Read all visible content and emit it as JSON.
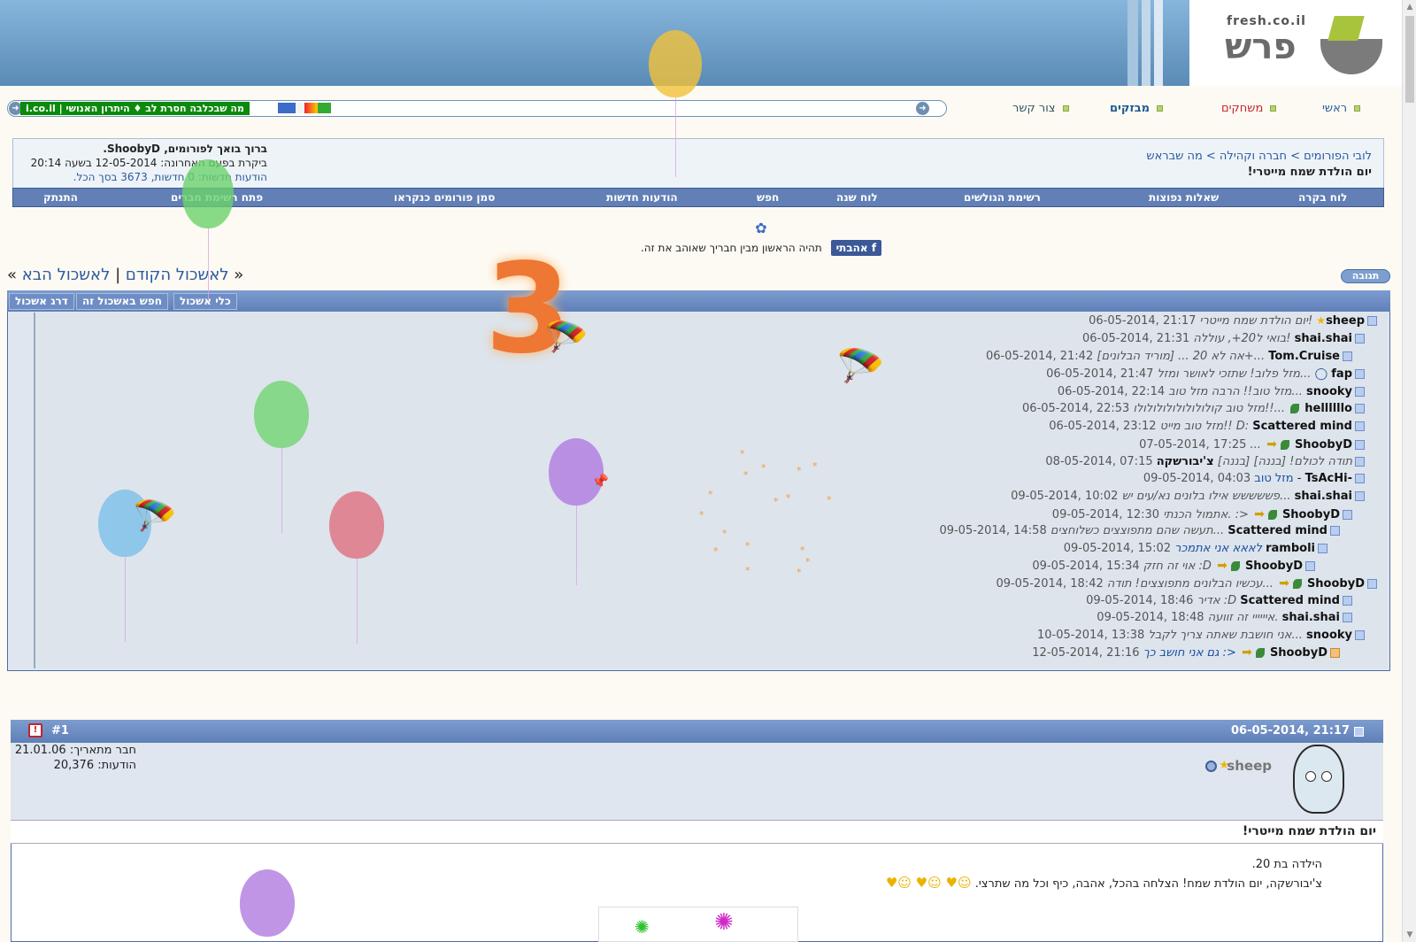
{
  "site": {
    "logo_url_text": "fresh.co.il",
    "logo_text": "פרש"
  },
  "top_nav": [
    "ראשי",
    "משחקים",
    "מבזקים",
    "צור קשר"
  ],
  "ticker": {
    "message": "מה שבכלבה חסרת לב ♦ היתרון האנושי | i.co.il"
  },
  "welcome": {
    "line1": "ברוך בואך לפורומים, ShoobyD.",
    "line2": "ביקרת בפעם האחרונה: 12-05-2014 בשעה 20:14",
    "line3": "הודעות חדשות: 0 חדשות, 3673 בסך הכל."
  },
  "breadcrumb": {
    "path": "לובי הפורומים > חברה וקהילה > מה שבראש",
    "title": "יום הולדת שמח מייטרי!"
  },
  "navbar": [
    "לוח בקרה",
    "שאלות נפוצות",
    "רשימת הגולשים",
    "לוח שנה",
    "חפש",
    "הודעות חדשות",
    "סמן פורומים כנקראו",
    "פתח רשימת חברים",
    "התנתק"
  ],
  "facebook": {
    "like_label": "אהבתי",
    "text": "תהיה הראשון מבין חבריך שאוהב את זה."
  },
  "thread_nav": {
    "prev": "לאשכול הקודם",
    "next": "לאשכול הבא",
    "sep": "|"
  },
  "reply_label": "תגובה",
  "thread_tools": [
    "כלי אשכול",
    "חפש באשכול זה",
    "דרג אשכול"
  ],
  "thread": [
    {
      "user": "sheep",
      "title": "יום הולדת שמח מייטרי!",
      "date": "06-05-2014, 21:17"
    },
    {
      "user": "shai.shai",
      "title": "בואי ל20+, עוללה!",
      "date": "06-05-2014, 21:31"
    },
    {
      "user": "Tom.Cruise",
      "title": "[מוריד הבלונים] ... אה לא 20+...",
      "date": "06-05-2014, 21:42"
    },
    {
      "user": "fap",
      "title": "מזל פלוב! שתזכי לאושר ומזל...",
      "date": "06-05-2014, 21:47"
    },
    {
      "user": "snooky",
      "title": "מזל טוב!! הרבה מזל טוב...",
      "date": "06-05-2014, 22:14"
    },
    {
      "user": "hellllllo",
      "title": "מזל טוב קולולולולולולולולו!!...",
      "date": "06-05-2014, 22:53"
    },
    {
      "user": "Scattered mind",
      "title": "מזל טוב מייט!! D:",
      "date": "06-05-2014, 23:12"
    },
    {
      "user": "ShoobyD",
      "title": "...",
      "date": "07-05-2014, 17:25"
    },
    {
      "user": "צ'יבורשקה",
      "title": "תודה לכולם! [בננה] [בננה]",
      "date": "08-05-2014, 07:15"
    },
    {
      "user": "TsAcHi-",
      "title": "מזל טוב",
      "date": "09-05-2014, 04:03"
    },
    {
      "user": "shai.shai",
      "title": "פששששש אילו בלונים נא/עים יש...",
      "date": "09-05-2014, 10:02"
    },
    {
      "user": "ShoobyD",
      "title": "אתמול הכנתי. :>",
      "date": "09-05-2014, 12:30"
    },
    {
      "user": "Scattered mind",
      "title": "תעשה שהם מתפוצצים כשלוחצים...",
      "date": "09-05-2014, 14:58"
    },
    {
      "user": "ramboli",
      "title": "לאאא אני אתמכר",
      "date": "09-05-2014, 15:02"
    },
    {
      "user": "ShoobyD",
      "title": "אוי זה חזק :D",
      "date": "09-05-2014, 15:34"
    },
    {
      "user": "ShoobyD",
      "title": "עכשיו הבלונים מתפוצצים! תודה...",
      "date": "09-05-2014, 18:42"
    },
    {
      "user": "Scattered mind",
      "title": "אדיר :D",
      "date": "09-05-2014, 18:46"
    },
    {
      "user": "shai.shai",
      "title": "איייייי זה זוועה.",
      "date": "09-05-2014, 18:48"
    },
    {
      "user": "snooky",
      "title": "אני חושבת שאתה צריך לקבל...",
      "date": "10-05-2014, 13:38"
    },
    {
      "user": "ShoobyD",
      "title": "גם אני חושב כך :>",
      "date": "12-05-2014, 21:16"
    }
  ],
  "post": {
    "date": "06-05-2014, 21:17",
    "number": "#1",
    "user": "sheep",
    "member_since_label": "חבר מתאריך:",
    "member_since": "21.01.06",
    "posts_label": "הודעות:",
    "posts": "20,376",
    "title": "יום הולדת שמח מייטרי!",
    "body1": "הילדה בת 20.",
    "body2": "צ'יבורשקה, יום הולדת שמח! הצלחה בהכל, אהבה, כיף וכל מה שתרצי."
  },
  "countdown": "3",
  "colors": {
    "accent": "#6280b6",
    "ticker_green": "#0b8a0b",
    "link": "#2a5aa0"
  }
}
